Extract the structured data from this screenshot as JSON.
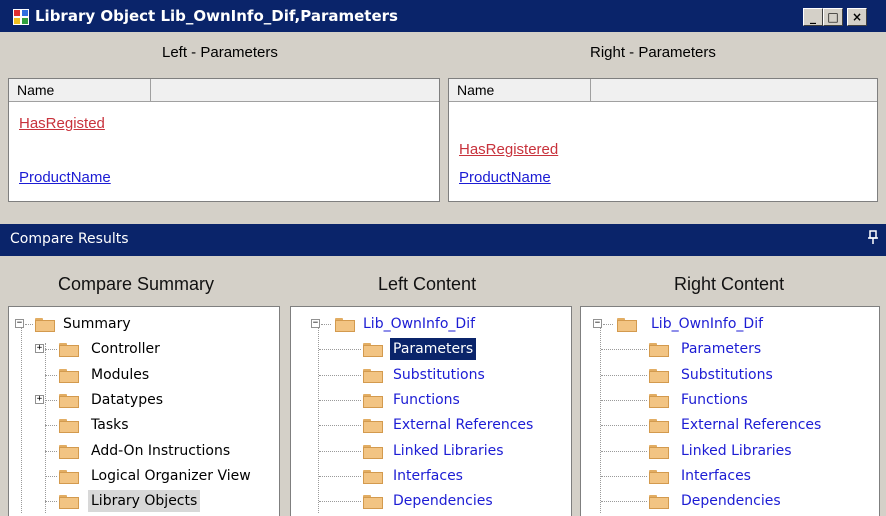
{
  "window": {
    "title": "Library Object Lib_OwnInfo_Dif,Parameters",
    "buttons": {
      "minimize": "_",
      "maximize": "□",
      "close": "×"
    }
  },
  "left_panel": {
    "heading": "Left - Parameters",
    "column_name": "Name",
    "items": [
      {
        "label": "HasRegisted",
        "status": "changed"
      },
      {
        "label": "ProductName",
        "status": "same"
      }
    ]
  },
  "right_panel": {
    "heading": "Right - Parameters",
    "column_name": "Name",
    "items": [
      {
        "label": "HasRegistered",
        "status": "changed"
      },
      {
        "label": "ProductName",
        "status": "same"
      }
    ]
  },
  "compare_results": {
    "title": "Compare Results",
    "pin_icon": "pin-icon"
  },
  "summary": {
    "heading": "Compare Summary",
    "root": "Summary",
    "items": [
      "Controller",
      "Modules",
      "Datatypes",
      "Tasks",
      "Add-On Instructions",
      "Logical Organizer View",
      "Library Objects"
    ]
  },
  "left_content": {
    "heading": "Left Content",
    "root": "Lib_OwnInfo_Dif",
    "items": [
      "Parameters",
      "Substitutions",
      "Functions",
      "External References",
      "Linked Libraries",
      "Interfaces",
      "Dependencies"
    ]
  },
  "right_content": {
    "heading": "Right Content",
    "root": "Lib_OwnInfo_Dif",
    "items": [
      "Parameters",
      "Substitutions",
      "Functions",
      "External References",
      "Linked Libraries",
      "Interfaces",
      "Dependencies"
    ]
  },
  "colors": {
    "title_bar": "#0a246a",
    "changed": "#c8323c",
    "same": "#1c1cd4",
    "folder": "#f2c483"
  }
}
